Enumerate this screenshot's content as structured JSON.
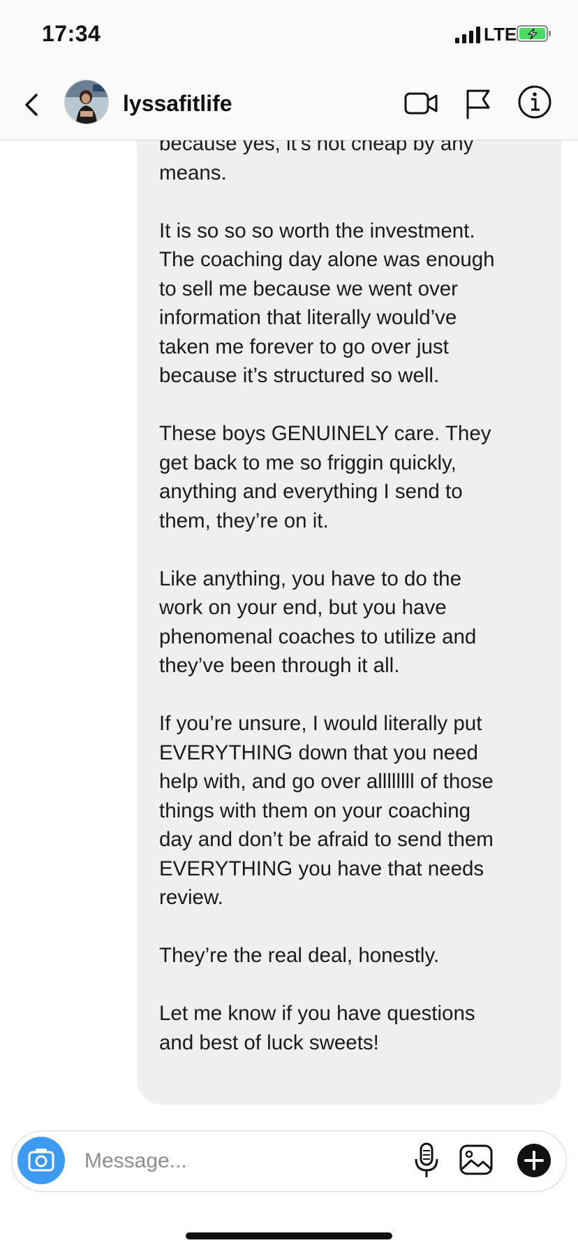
{
  "status_bar": {
    "time": "17:34",
    "network": "LTE",
    "signal_icon": "signal-bars-icon",
    "battery_icon": "battery-charging-icon"
  },
  "header": {
    "username": "lyssafitlife",
    "icons": [
      "back-chevron-icon",
      "video-call-icon",
      "flag-icon",
      "info-icon"
    ]
  },
  "message": {
    "paragraphs": [
      "because yes, it’s not cheap by any means.",
      "It is so so so worth the investment. The coaching day alone was enough to sell me because we went over information that literally would’ve taken me forever to go over just because it’s structured so well.",
      "These boys GENUINELY care. They get back to me so friggin quickly, anything and everything I send to them, they’re on it.",
      "Like anything, you have to do the work on your end, but you have phenomenal coaches to utilize and they’ve been through it all.",
      "If you’re unsure, I would literally put EVERYTHING down that you need help with, and go over allllllll of those things with them on your coaching day and don’t be afraid to send them EVERYTHING you have that needs review.",
      "They’re the real deal, honestly.",
      "Let me know if you have questions and best of luck sweets!"
    ],
    "lines": [
      [
        "because yes, it’s not cheap by any",
        "means."
      ],
      [
        "It is so so so worth the investment.",
        "The coaching day alone was enough",
        "to sell me because we went over",
        "information that literally would’ve",
        "taken me forever to go over just",
        "because it’s structured so well."
      ],
      [
        "These boys GENUINELY care. They",
        "get back to me so friggin quickly,",
        "anything and everything I send to",
        "them, they’re on it."
      ],
      [
        "Like anything, you have to do the",
        "work on your end, but you have",
        "phenomenal coaches to utilize and",
        "they’ve been through it all."
      ],
      [
        "If you’re unsure, I would literally put",
        "EVERYTHING down that you need",
        "help with, and go over allllllll of those",
        "things with them on your coaching",
        "day and don’t be afraid to send them",
        "EVERYTHING you have that needs",
        "review."
      ],
      [
        "They’re the real deal, honestly."
      ],
      [
        "Let me know if you have questions",
        "and best of luck sweets!"
      ]
    ]
  },
  "composer": {
    "placeholder": "Message...",
    "icons": [
      "camera-icon",
      "microphone-icon",
      "gallery-icon",
      "plus-icon"
    ]
  },
  "colors": {
    "bubble": "#efefef",
    "camera_button": "#3c9af0",
    "battery_fill": "#4cd964"
  }
}
